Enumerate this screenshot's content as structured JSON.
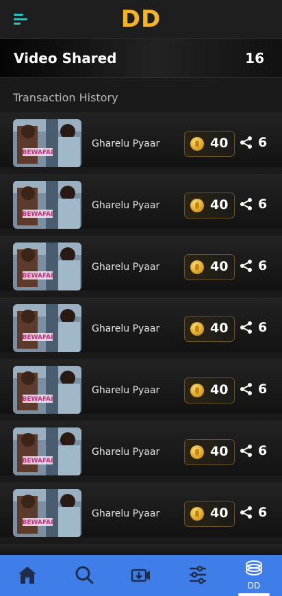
{
  "header": {
    "logo": "DD",
    "menu_icon": "menu-icon"
  },
  "summary": {
    "label": "Video Shared",
    "count": "16"
  },
  "section_title": "Transaction History",
  "transactions": [
    {
      "title": "Gharelu Pyaar",
      "coins": "40",
      "shares": "6",
      "thumb_text": "BEWAFAI"
    },
    {
      "title": "Gharelu Pyaar",
      "coins": "40",
      "shares": "6",
      "thumb_text": "BEWAFAI"
    },
    {
      "title": "Gharelu Pyaar",
      "coins": "40",
      "shares": "6",
      "thumb_text": "BEWAFAI"
    },
    {
      "title": "Gharelu Pyaar",
      "coins": "40",
      "shares": "6",
      "thumb_text": "BEWAFAI"
    },
    {
      "title": "Gharelu Pyaar",
      "coins": "40",
      "shares": "6",
      "thumb_text": "BEWAFAI"
    },
    {
      "title": "Gharelu Pyaar",
      "coins": "40",
      "shares": "6",
      "thumb_text": "BEWAFAI"
    },
    {
      "title": "Gharelu Pyaar",
      "coins": "40",
      "shares": "6",
      "thumb_text": "BEWAFAI"
    }
  ],
  "bottom_nav": {
    "items": [
      "home-icon",
      "search-icon",
      "video-download-icon",
      "filter-sliders-icon",
      "coins-stack-icon"
    ],
    "active_label": "DD"
  },
  "colors": {
    "accent": "#f4b427",
    "nav": "#3f7ee8",
    "menu": "#2ec4c4"
  }
}
